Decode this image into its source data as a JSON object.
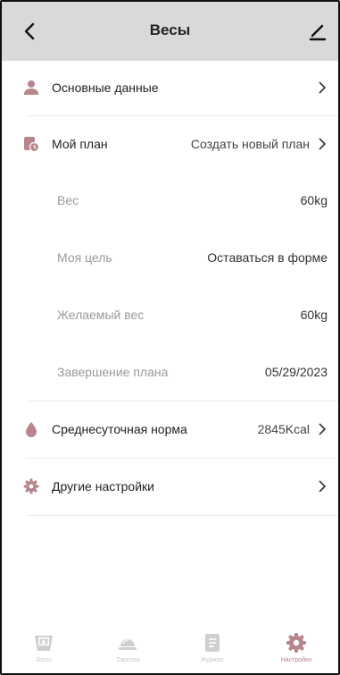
{
  "header": {
    "title": "Весы"
  },
  "rows": {
    "basic": {
      "label": "Основные данные"
    },
    "plan": {
      "label": "Мой план",
      "value": "Создать новый план"
    },
    "weight": {
      "label": "Вес",
      "value": "60kg"
    },
    "goal": {
      "label": "Моя цель",
      "value": "Оставаться в форме"
    },
    "target_weight": {
      "label": "Желаемый вес",
      "value": "60kg"
    },
    "plan_end": {
      "label": "Завершение плана",
      "value": "05/29/2023"
    },
    "daily_norm": {
      "label": "Среднесуточная норма",
      "value": "2845Kcal"
    },
    "other": {
      "label": "Другие настройки"
    }
  },
  "tabbar": {
    "tabs": [
      {
        "label": "Весы",
        "icon": "scale-icon",
        "active": false
      },
      {
        "label": "Тарелка",
        "icon": "plate-icon",
        "active": false
      },
      {
        "label": "Журнал",
        "icon": "journal-icon",
        "active": false
      },
      {
        "label": "Настройки",
        "icon": "gear-icon",
        "active": true
      }
    ]
  },
  "colors": {
    "accent": "#b8848d",
    "header_bg": "#d9d9d9",
    "inactive_icon": "#c9c9c9",
    "divider": "#ececec"
  }
}
